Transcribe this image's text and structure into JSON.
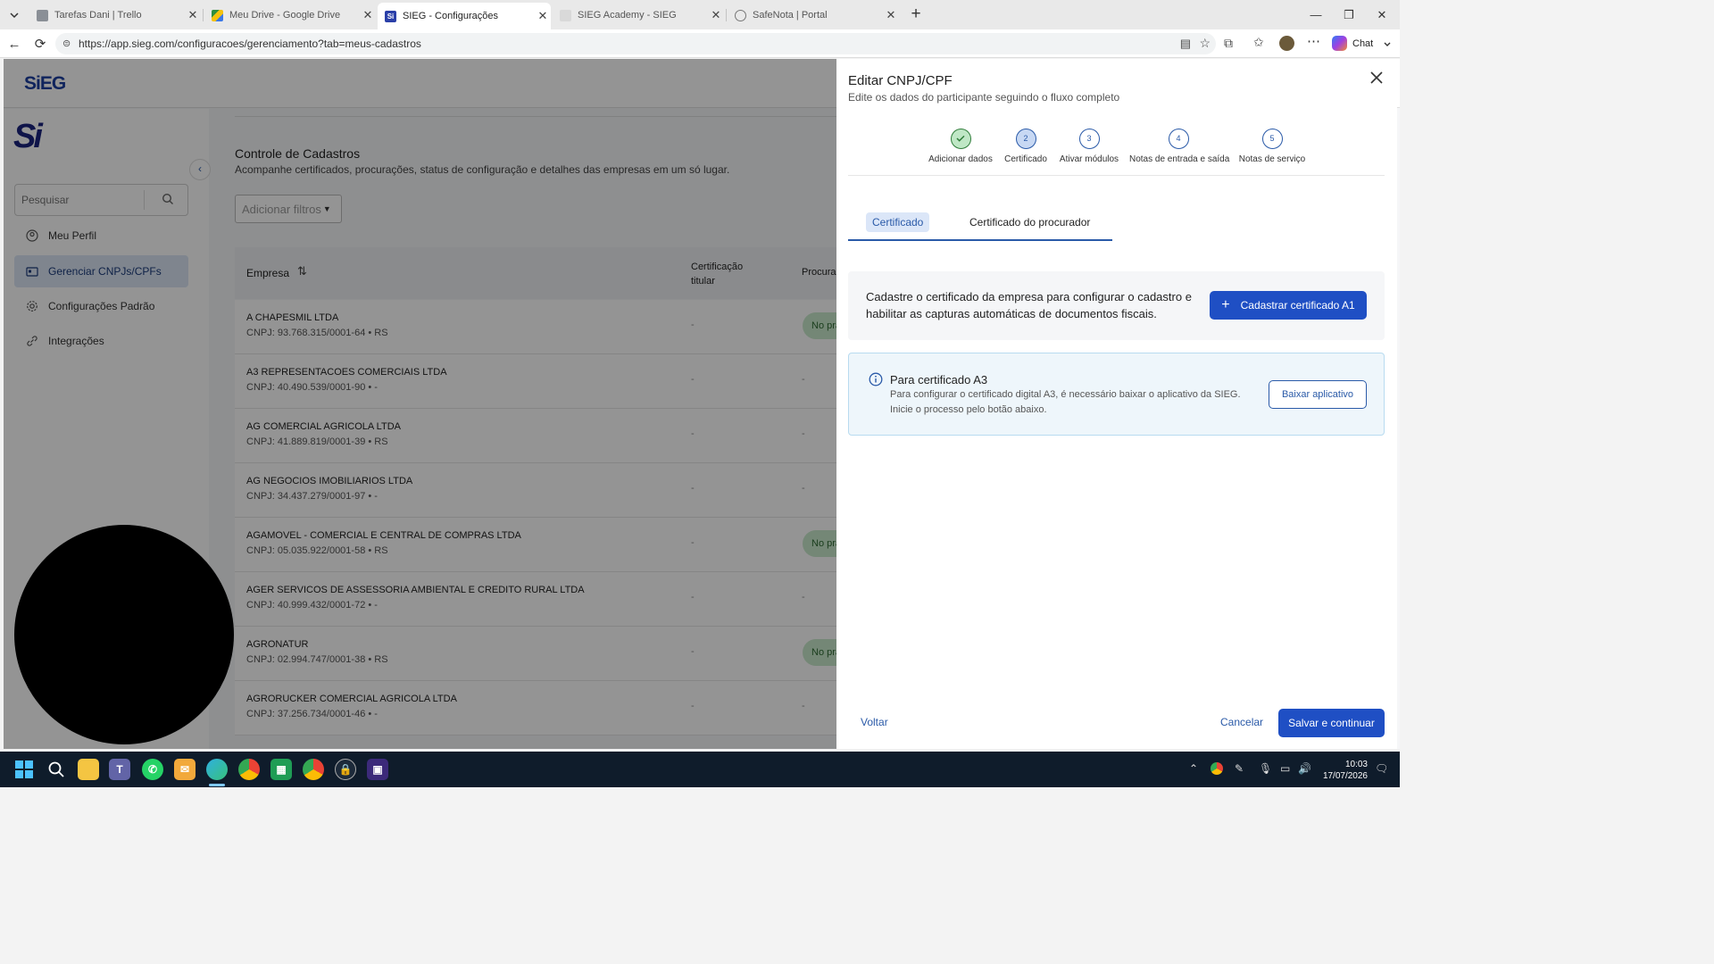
{
  "browser": {
    "tabs": [
      {
        "label": "Tarefas Dani | Trello",
        "color": "#8a8f96",
        "left": 0
      },
      {
        "label": "Meu Drive - Google Drive",
        "color": "#2f8f3e"
      },
      {
        "label": "SIEG - Configurações",
        "color": "#2a3fa8"
      },
      {
        "label": "SIEG Academy - SIEG",
        "color": "#d0d0d0"
      },
      {
        "label": "SafeNota | Portal",
        "color": "#8a8f96"
      }
    ],
    "url": "https://app.sieg.com/configuracoes/gerenciamento?tab=meus-cadastros",
    "chat_label": "Chat"
  },
  "app": {
    "logo_text": "SiEG",
    "big_logo": "Si",
    "search_placeholder": "Pesquisar",
    "menu": [
      {
        "label": "Meu Perfil",
        "icon": "profile-icon"
      },
      {
        "label": "Gerenciar CNPJs/CPFs",
        "icon": "id-card-icon"
      },
      {
        "label": "Configurações Padrão",
        "icon": "gear-icon"
      },
      {
        "label": "Integrações",
        "icon": "link-icon"
      }
    ],
    "page_title": "Controle de Cadastros",
    "page_subtitle": "Acompanhe certificados, procurações, status de configuração e detalhes das empresas em um só lugar.",
    "filter_label": "Adicionar filtros",
    "columns": {
      "empresa": "Empresa",
      "cert": "Certificação titular",
      "proc": "Procura"
    },
    "rows": [
      {
        "name": "A CHAPESMIL LTDA",
        "cnpj": "CNPJ: 93.768.315/0001-64 • RS",
        "c1": "-",
        "c2": "No pra",
        "pill": true
      },
      {
        "name": "A3 REPRESENTACOES COMERCIAIS LTDA",
        "cnpj": "CNPJ: 40.490.539/0001-90 • -",
        "c1": "-",
        "c2": "-",
        "pill": false
      },
      {
        "name": "AG COMERCIAL AGRICOLA LTDA",
        "cnpj": "CNPJ: 41.889.819/0001-39 • RS",
        "c1": "-",
        "c2": "-",
        "pill": false
      },
      {
        "name": "AG NEGOCIOS IMOBILIARIOS LTDA",
        "cnpj": "CNPJ: 34.437.279/0001-97 • -",
        "c1": "-",
        "c2": "-",
        "pill": false
      },
      {
        "name": "AGAMOVEL - COMERCIAL E CENTRAL DE COMPRAS LTDA",
        "cnpj": "CNPJ: 05.035.922/0001-58 • RS",
        "c1": "-",
        "c2": "No pra",
        "pill": true
      },
      {
        "name": "AGER SERVICOS DE ASSESSORIA AMBIENTAL E CREDITO RURAL LTDA",
        "cnpj": "CNPJ: 40.999.432/0001-72 • -",
        "c1": "-",
        "c2": "-",
        "pill": false
      },
      {
        "name": "AGRONATUR",
        "cnpj": "CNPJ: 02.994.747/0001-38 • RS",
        "c1": "-",
        "c2": "No pra",
        "pill": true
      },
      {
        "name": "AGRORUCKER COMERCIAL AGRICOLA LTDA",
        "cnpj": "CNPJ: 37.256.734/0001-46 • -",
        "c1": "-",
        "c2": "-",
        "pill": false
      }
    ]
  },
  "panel": {
    "title": "Editar CNPJ/CPF",
    "subtitle": "Edite os dados do participante seguindo o fluxo completo",
    "steps": [
      {
        "num": "",
        "label": "Adicionar dados",
        "state": "done"
      },
      {
        "num": "2",
        "label": "Certificado",
        "state": "current"
      },
      {
        "num": "3",
        "label": "Ativar módulos",
        "state": "todo"
      },
      {
        "num": "4",
        "label": "Notas de entrada e saída",
        "state": "todo"
      },
      {
        "num": "5",
        "label": "Notas de serviço",
        "state": "todo"
      }
    ],
    "tab_cert": "Certificado",
    "tab_proc": "Certificado do procurador",
    "cert_text_1": "Cadastre o certificado da empresa para configurar o cadastro e",
    "cert_text_2": "habilitar as capturas automáticas de documentos fiscais.",
    "cert_button": "Cadastrar certificado A1",
    "a3_title": "Para certificado A3",
    "a3_text_1": "Para configurar o certificado digital A3, é necessário baixar o aplicativo da SIEG.",
    "a3_text_2": "Inicie o processo pelo botão abaixo.",
    "a3_button": "Baixar aplicativo",
    "back_label": "Voltar",
    "cancel_label": "Cancelar",
    "save_label": "Salvar e continuar"
  },
  "taskbar": {
    "time": "10:03",
    "date": "17/07/2026"
  }
}
